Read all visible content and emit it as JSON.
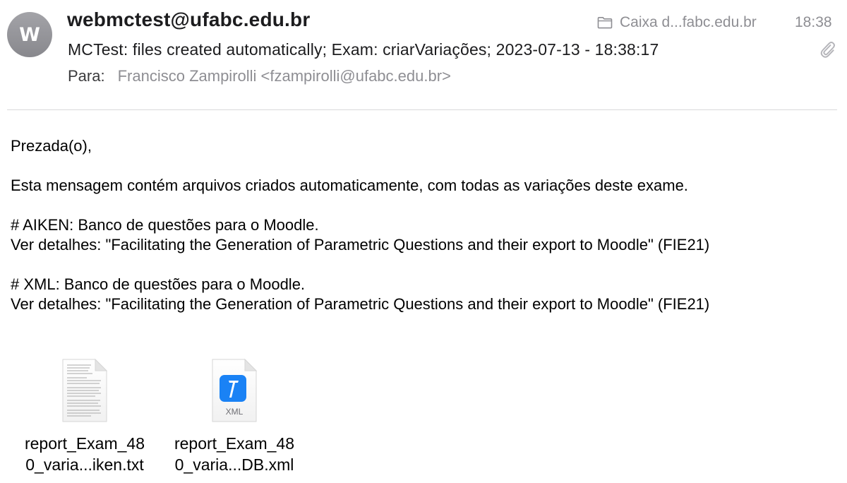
{
  "header": {
    "avatar_initial": "W",
    "sender": "webmctest@ufabc.edu.br",
    "mailbox": "Caixa d...fabc.edu.br",
    "time": "18:38",
    "subject": "MCTest: files created automatically; Exam: criarVariações; 2023-07-13 - 18:38:17",
    "to_label": "Para:",
    "to_value": "Francisco Zampirolli <fzampirolli@ufabc.edu.br>"
  },
  "body": {
    "greeting": "Prezada(o),",
    "intro": "Esta mensagem contém arquivos criados automaticamente, com todas as variações deste exame.",
    "aiken_line": "# AIKEN: Banco de questões para o Moodle.",
    "aiken_detail": "Ver detalhes: \"Facilitating the Generation of Parametric Questions and their export to Moodle\" (FIE21)",
    "xml_line": "# XML:  Banco de questões para o Moodle.",
    "xml_detail": "Ver detalhes: \"Facilitating the Generation of Parametric Questions and their export to Moodle\" (FIE21)"
  },
  "attachments": [
    {
      "icon": "text-document-icon",
      "name_line1": "report_Exam_48",
      "name_line2": "0_varia...iken.txt"
    },
    {
      "icon": "xml-document-icon",
      "icon_label": "XML",
      "name_line1": "report_Exam_48",
      "name_line2": "0_varia...DB.xml"
    }
  ],
  "colors": {
    "secondary_text": "#8e8e93",
    "xml_badge": "#1a82f5"
  }
}
